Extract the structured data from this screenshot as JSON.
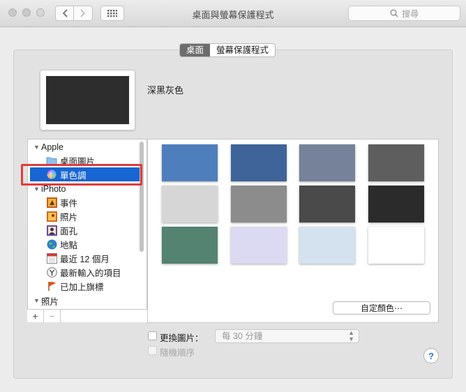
{
  "window": {
    "title": "桌面與螢幕保護程式"
  },
  "search": {
    "placeholder": "搜尋"
  },
  "tabs": [
    {
      "label": "桌面",
      "selected": true
    },
    {
      "label": "螢幕保護程式",
      "selected": false
    }
  ],
  "current": {
    "color_name": "深黑灰色"
  },
  "sidebar": {
    "groups": [
      {
        "label": "Apple",
        "items": [
          {
            "label": "桌面圖片",
            "icon": "folder-icon"
          },
          {
            "label": "單色調",
            "icon": "color-wheel-icon",
            "selected": true
          }
        ]
      },
      {
        "label": "iPhoto",
        "items": [
          {
            "label": "事件",
            "icon": "events-icon"
          },
          {
            "label": "照片",
            "icon": "photos-icon"
          },
          {
            "label": "面孔",
            "icon": "faces-icon"
          },
          {
            "label": "地點",
            "icon": "globe-icon"
          },
          {
            "label": "最近 12 個月",
            "icon": "calendar-icon"
          },
          {
            "label": "最新輸入的項目",
            "icon": "import-icon"
          },
          {
            "label": "已加上旗標",
            "icon": "flag-icon"
          }
        ]
      },
      {
        "label": "照片",
        "items": []
      }
    ],
    "add_label": "+",
    "remove_label": "−"
  },
  "swatches": [
    "#4f7ebd",
    "#3f6499",
    "#75829a",
    "#5e5e5e",
    "#d6d6d6",
    "#8c8c8c",
    "#4a4a4a",
    "#2b2b2b",
    "#548372",
    "#dcd9f2",
    "#d4e2f0",
    "#ffffff"
  ],
  "custom_color_button": "自定顏色⋯",
  "change_picture": {
    "label": "更換圖片：",
    "checked": false,
    "interval": "每 30 分鐘"
  },
  "random_order": {
    "label": "隨機順序",
    "checked": false,
    "enabled": false
  },
  "help_label": "?"
}
